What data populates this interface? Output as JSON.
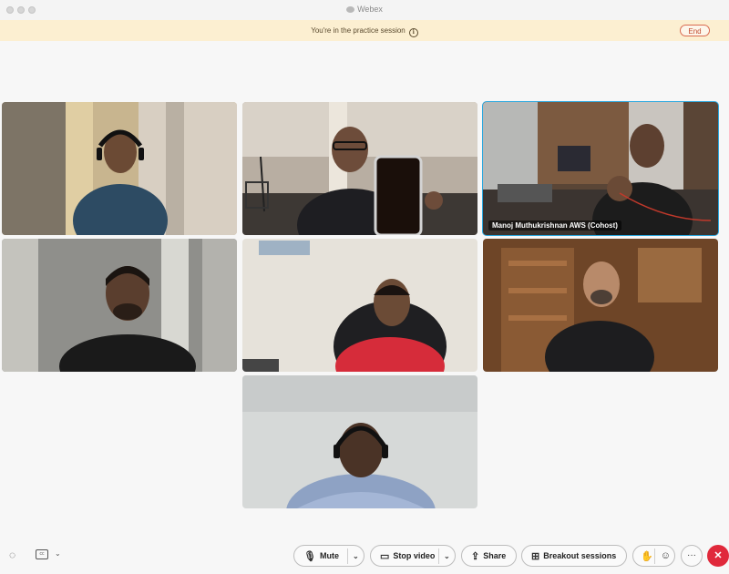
{
  "window": {
    "title": "Webex"
  },
  "banner": {
    "text": "You're in the practice session",
    "end_label": "End"
  },
  "tiles": [
    {
      "name": ""
    },
    {
      "name": ""
    },
    {
      "name": "Manoj Muthukrishnan AWS  (Cohost)",
      "active": true
    },
    {
      "name": ""
    },
    {
      "name": ""
    },
    {
      "name": ""
    },
    {
      "name": ""
    }
  ],
  "controls": {
    "mute_label": "Mute",
    "stop_video_label": "Stop video",
    "share_label": "Share",
    "breakout_label": "Breakout sessions",
    "more_label": "···"
  },
  "icons": {
    "mute": "microphone-icon",
    "video": "camera-icon",
    "share": "share-screen-icon",
    "breakout": "breakout-grid-icon",
    "raise_hand": "raise-hand-icon",
    "reactions": "emoji-icon",
    "leave": "close-icon",
    "captions": "captions-icon",
    "ai_assistant": "assistant-icon"
  },
  "colors": {
    "banner_bg": "#fcefd1",
    "active_outline": "#29a7df",
    "leave": "#e0293b",
    "end": "#d96b50"
  }
}
